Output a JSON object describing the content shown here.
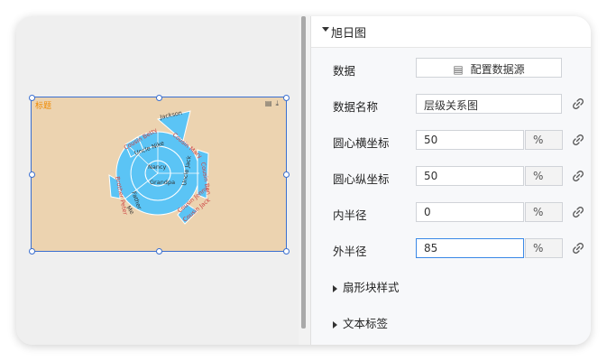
{
  "chart": {
    "title": "标题",
    "labels": {
      "jackson": "Jackson",
      "nancy": "Nancy",
      "uncle_nike": "Uncle Nike",
      "grandpa": "Grandpa",
      "father": "Father",
      "me": "Me",
      "brother_peter": "Brother Peter",
      "uncle_jack": "Uncle Jack",
      "cousin_mary": "Cousin Mary",
      "cousin_ben": "Cousin Ben",
      "cousin_betty": "Cousin Betty",
      "cousin_jenny": "Cousin Jenny",
      "cousin_jack": "Cousin Jack"
    }
  },
  "panel": {
    "section_title": "旭日图",
    "rows": {
      "data": {
        "label": "数据",
        "button": "配置数据源"
      },
      "data_name": {
        "label": "数据名称",
        "value": "层级关系图"
      },
      "center_x": {
        "label": "圆心横坐标",
        "value": "50",
        "unit": "%"
      },
      "center_y": {
        "label": "圆心纵坐标",
        "value": "50",
        "unit": "%"
      },
      "inner_radius": {
        "label": "内半径",
        "value": "0",
        "unit": "%"
      },
      "outer_radius": {
        "label": "外半径",
        "value": "85",
        "unit": "%"
      }
    },
    "subsections": {
      "sector_style": "扇形块样式",
      "text_label": "文本标签"
    }
  }
}
